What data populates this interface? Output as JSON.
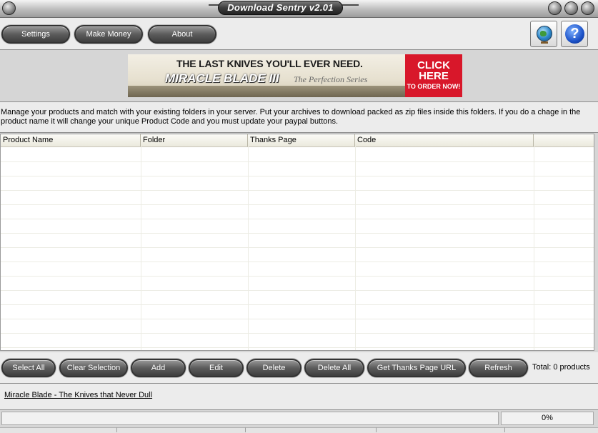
{
  "window": {
    "title": "Download Sentry v2.01"
  },
  "toolbar": {
    "buttons": [
      {
        "id": "settings",
        "label": "Settings"
      },
      {
        "id": "make-money",
        "label": "Make Money"
      },
      {
        "id": "about",
        "label": "About"
      }
    ],
    "icons": [
      "globe-icon",
      "help-icon"
    ]
  },
  "banner": {
    "headline": "THE LAST KNIVES YOU'LL EVER NEED.",
    "brand": "MIRACLE BLADE III",
    "subtitle": "The Perfection Series",
    "cta_main": "CLICK HERE",
    "cta_sub": "TO ORDER NOW!",
    "cta_color": "#d8172a"
  },
  "info_text": "Manage your products and match with your existing folders in your server. Put your archives to download packed as zip files inside this folders. If you do a chage in the product name it will change your unique Product Code and you must update your paypal buttons.",
  "table": {
    "columns": [
      "Product Name",
      "Folder",
      "Thanks Page",
      "Code",
      ""
    ],
    "rows": []
  },
  "actions": {
    "buttons": [
      "Select All",
      "Clear Selection",
      "Add",
      "Edit",
      "Delete",
      "Delete All",
      "Get Thanks Page URL",
      "Refresh"
    ],
    "total_label": "Total: 0 products"
  },
  "footer": {
    "link_text": "Miracle Blade - The Knives that Never Dull"
  },
  "status": {
    "message": "",
    "progress": "0%"
  }
}
